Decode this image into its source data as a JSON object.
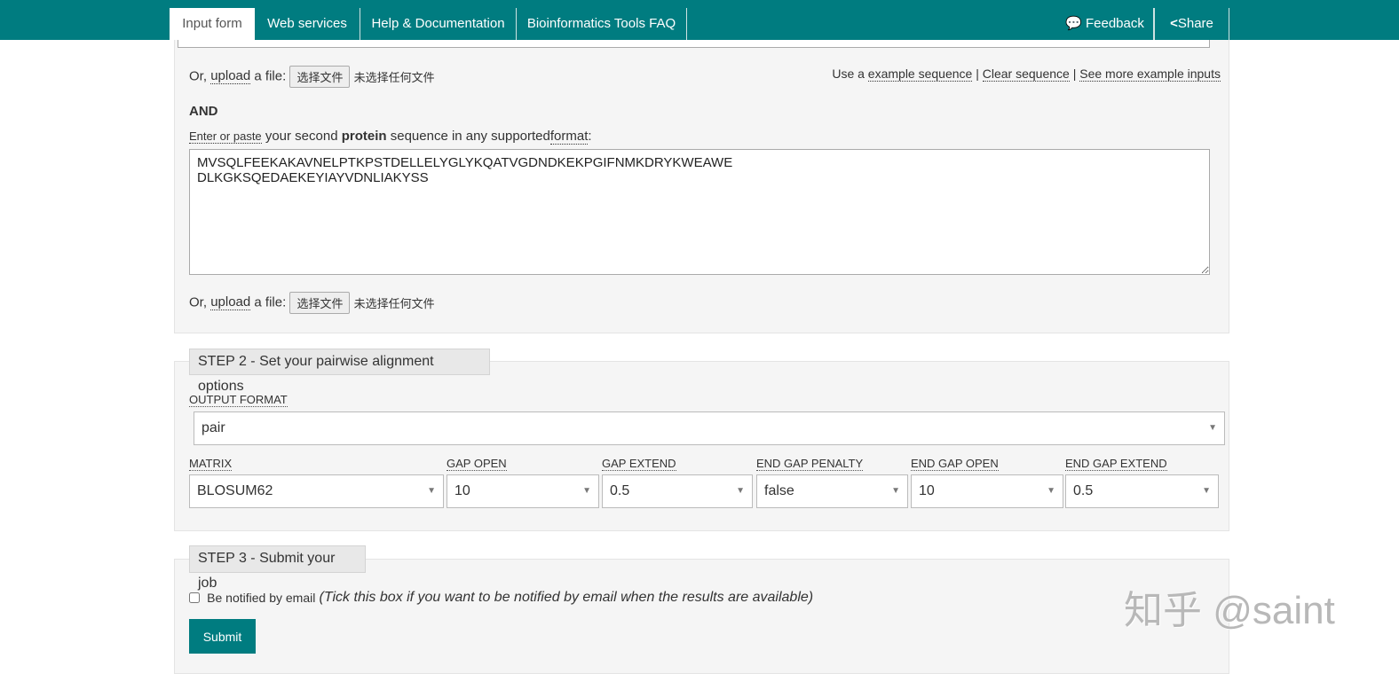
{
  "nav": {
    "tabs": [
      "Input form",
      "Web services",
      "Help & Documentation",
      "Bioinformatics Tools FAQ"
    ],
    "feedback": "Feedback",
    "share": "Share"
  },
  "step1": {
    "upload_prefix": "Or,",
    "upload_link": "upload",
    "upload_suffix": "a file:",
    "file_button": "选择文件",
    "file_status": "未选择任何文件",
    "use_a": "Use a",
    "example_link": "example sequence",
    "clear_link": "Clear sequence",
    "more_link": "See more example inputs",
    "sep": "|",
    "and": "AND",
    "enter_link": "Enter or paste",
    "second_pre": "your second",
    "protein": "protein",
    "second_post": "sequence in any supported",
    "format_link": "format",
    "sequence": "MVSQLFEEKAKAVNELPTKPSTDELLELYGLYKQATVGDNDKEKPGIFNMKDRYKWEAWE\nDLKGKSQEDAEKEYIAYVDNLIAKYSS"
  },
  "step2": {
    "legend": "STEP 2 - Set your pairwise alignment options",
    "output_format": {
      "label": "OUTPUT FORMAT",
      "value": "pair"
    },
    "options": [
      {
        "label": "MATRIX",
        "value": "BLOSUM62"
      },
      {
        "label": "GAP OPEN",
        "value": "10"
      },
      {
        "label": "GAP EXTEND",
        "value": "0.5"
      },
      {
        "label": "END GAP PENALTY",
        "value": "false"
      },
      {
        "label": "END GAP OPEN",
        "value": "10"
      },
      {
        "label": "END GAP EXTEND",
        "value": "0.5"
      }
    ]
  },
  "step3": {
    "legend": "STEP 3 - Submit your job",
    "notify_label": "Be notified by email",
    "notify_hint": "(Tick this box if you want to be notified by email when the results are available)",
    "submit": "Submit"
  },
  "watermark": "知乎 @saint",
  "colors": {
    "brand": "#007c80"
  }
}
